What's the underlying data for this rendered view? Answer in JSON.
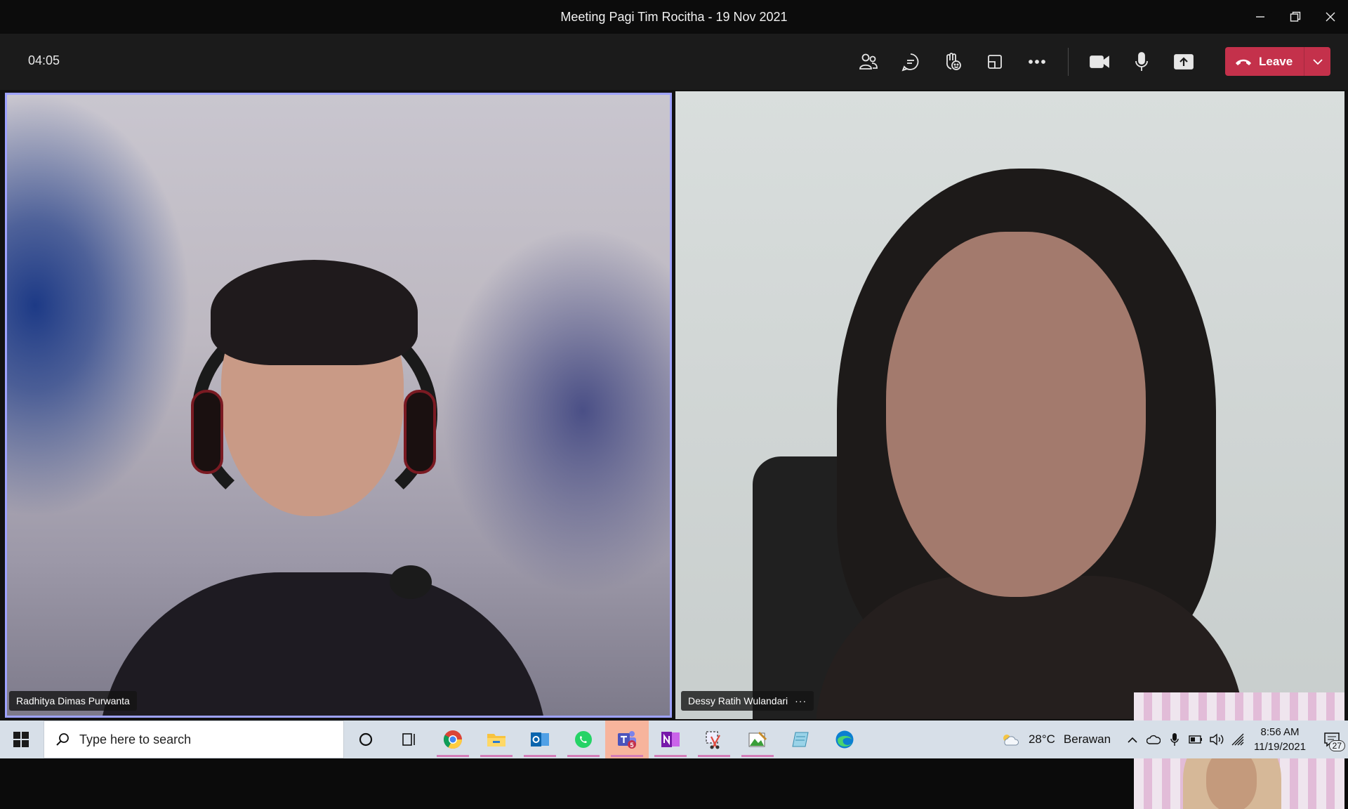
{
  "window": {
    "title": "Meeting Pagi Tim Rocitha - 19 Nov 2021"
  },
  "toolbar": {
    "timer": "04:05",
    "leave_label": "Leave",
    "icons": [
      "people-icon",
      "chat-icon",
      "reactions-icon",
      "rooms-icon",
      "more-icon",
      "camera-icon",
      "mic-icon",
      "share-icon"
    ]
  },
  "participants": [
    {
      "name": "Radhitya Dimas Purwanta"
    },
    {
      "name": "Dessy Ratih Wulandari",
      "more": "···"
    }
  ],
  "taskbar": {
    "search_placeholder": "Type here to search",
    "weather": {
      "temp": "28°C",
      "desc": "Berawan"
    },
    "clock": {
      "time": "8:56 AM",
      "date": "11/19/2021"
    },
    "notifications": "27",
    "teams_badge": "5"
  },
  "colors": {
    "leave": "#c4314b",
    "active_speaker_border": "#9ea2ff",
    "taskbar": "#d7dfe8"
  }
}
